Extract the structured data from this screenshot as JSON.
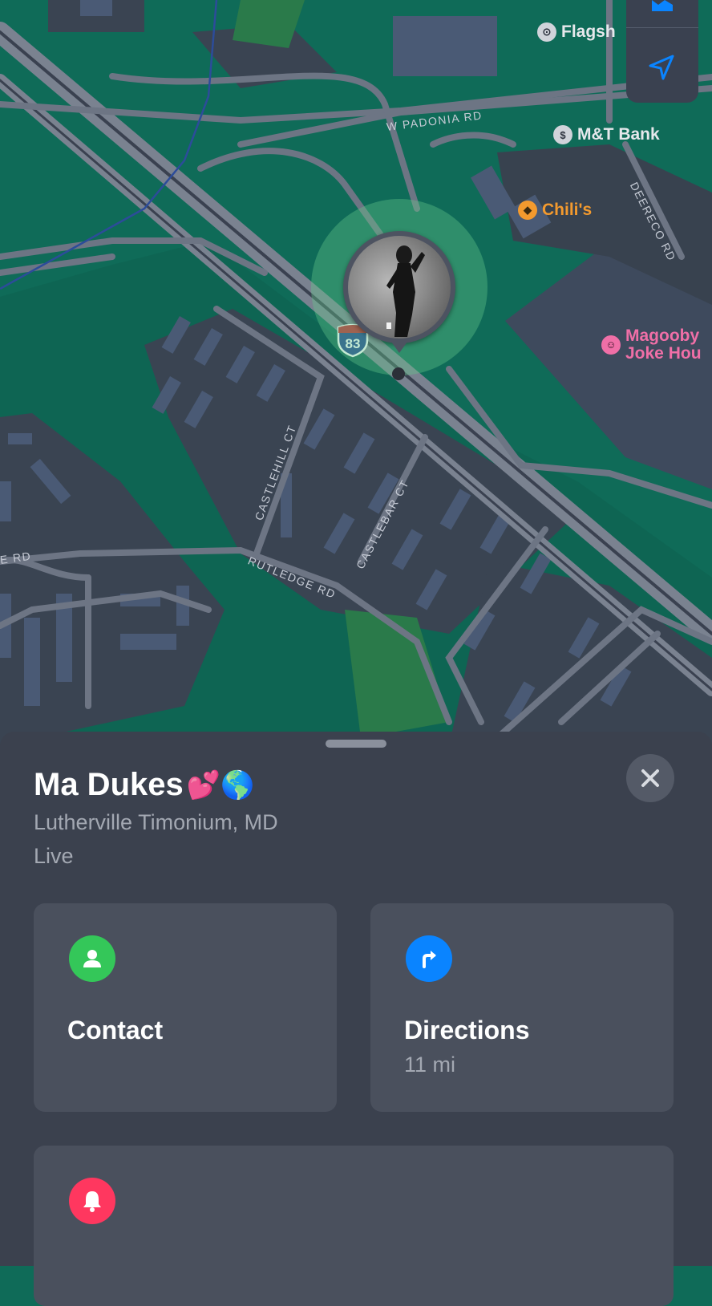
{
  "map": {
    "pois": {
      "flagship": "Flagsh",
      "mt_bank": "M&T Bank",
      "chilis": "Chili's",
      "magooby_line1": "Magooby",
      "magooby_line2": "Joke Hou"
    },
    "streets": {
      "w_padonia": "W PADONIA RD",
      "deereco": "DEERECO RD",
      "castlehill": "CASTLEHILL CT",
      "castlebar": "CASTLEBAR CT",
      "rutledge": "RUTLEDGE RD",
      "e_rd": "E RD"
    },
    "highway_shield": "83"
  },
  "person": {
    "name": "Ma Dukes",
    "name_emoji": "💕🌎",
    "location": "Lutherville Timonium, MD",
    "status": "Live"
  },
  "actions": {
    "contact_label": "Contact",
    "directions_label": "Directions",
    "directions_distance": "11 mi"
  },
  "colors": {
    "contact_icon": "#34c759",
    "directions_icon": "#0a84ff",
    "notify_icon": "#ff375f"
  },
  "icons": {
    "contact": "person-icon",
    "directions": "turn-right-arrow-icon",
    "notify": "bell-icon",
    "close": "close-icon",
    "map_location": "location-arrow-icon"
  }
}
